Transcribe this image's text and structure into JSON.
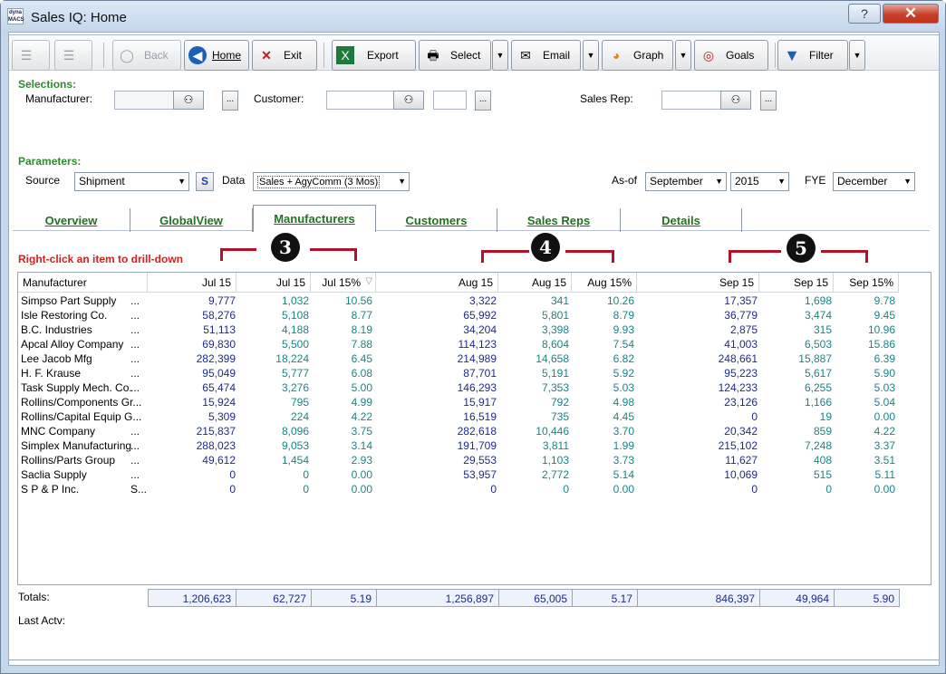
{
  "window": {
    "title": "Sales IQ: Home",
    "icon_text": "dyna MACS"
  },
  "toolbar": {
    "back": "Back",
    "home": "Home",
    "exit": "Exit",
    "export": "Export",
    "select": "Select",
    "email": "Email",
    "graph": "Graph",
    "goals": "Goals",
    "filter": "Filter"
  },
  "selections": {
    "heading": "Selections:",
    "manufacturer_label": "Manufacturer:",
    "customer_label": "Customer:",
    "sales_rep_label": "Sales Rep:",
    "ellipsis": "...",
    "binoculars": "⚇"
  },
  "parameters": {
    "heading": "Parameters:",
    "source_label": "Source",
    "source_value": "Shipment",
    "s_button": "S",
    "data_label": "Data",
    "data_value": "Sales + AgyComm (3 Mos)",
    "asof_label": "As-of",
    "asof_month": "September",
    "asof_year": "2015",
    "fye_label": "FYE",
    "fye_value": "December"
  },
  "tabs": [
    "Overview",
    "GlobalView",
    "Manufacturers",
    "Customers",
    "Sales Reps",
    "Details"
  ],
  "hint": "Right-click an item to drill-down",
  "badges": [
    "3",
    "4",
    "5"
  ],
  "grid": {
    "headers": [
      "Manufacturer",
      "Jul 15",
      "Jul 15",
      "Jul 15%",
      "Aug 15",
      "Aug 15",
      "Aug 15%",
      "Sep 15",
      "Sep 15",
      "Sep 15%"
    ],
    "rows": [
      {
        "name": "Simpso Part Supply",
        "more": "...",
        "v": [
          "9,777",
          "1,032",
          "10.56",
          "3,322",
          "341",
          "10.26",
          "17,357",
          "1,698",
          "9.78"
        ]
      },
      {
        "name": "Isle Restoring Co.",
        "more": "...",
        "v": [
          "58,276",
          "5,108",
          "8.77",
          "65,992",
          "5,801",
          "8.79",
          "36,779",
          "3,474",
          "9.45"
        ]
      },
      {
        "name": "B.C. Industries",
        "more": "...",
        "v": [
          "51,113",
          "4,188",
          "8.19",
          "34,204",
          "3,398",
          "9.93",
          "2,875",
          "315",
          "10.96"
        ]
      },
      {
        "name": "Apcal Alloy Company",
        "more": "...",
        "v": [
          "69,830",
          "5,500",
          "7.88",
          "114,123",
          "8,604",
          "7.54",
          "41,003",
          "6,503",
          "15.86"
        ]
      },
      {
        "name": "Lee Jacob Mfg",
        "more": "...",
        "v": [
          "282,399",
          "18,224",
          "6.45",
          "214,989",
          "14,658",
          "6.82",
          "248,661",
          "15,887",
          "6.39"
        ]
      },
      {
        "name": "H. F. Krause",
        "more": "...",
        "v": [
          "95,049",
          "5,777",
          "6.08",
          "87,701",
          "5,191",
          "5.92",
          "95,223",
          "5,617",
          "5.90"
        ]
      },
      {
        "name": "Task Supply Mech. Co.",
        "more": "...",
        "v": [
          "65,474",
          "3,276",
          "5.00",
          "146,293",
          "7,353",
          "5.03",
          "124,233",
          "6,255",
          "5.03"
        ]
      },
      {
        "name": "Rollins/Components Gr...",
        "more": "",
        "v": [
          "15,924",
          "795",
          "4.99",
          "15,917",
          "792",
          "4.98",
          "23,126",
          "1,166",
          "5.04"
        ]
      },
      {
        "name": "Rollins/Capital Equip G...",
        "more": "",
        "v": [
          "5,309",
          "224",
          "4.22",
          "16,519",
          "735",
          "4.45",
          "0",
          "19",
          "0.00"
        ]
      },
      {
        "name": "MNC Company",
        "more": "...",
        "v": [
          "215,837",
          "8,096",
          "3.75",
          "282,618",
          "10,446",
          "3.70",
          "20,342",
          "859",
          "4.22"
        ]
      },
      {
        "name": "Simplex Manufacturing",
        "more": "...",
        "v": [
          "288,023",
          "9,053",
          "3.14",
          "191,709",
          "3,811",
          "1.99",
          "215,102",
          "7,248",
          "3.37"
        ]
      },
      {
        "name": "Rollins/Parts Group",
        "more": "...",
        "v": [
          "49,612",
          "1,454",
          "2.93",
          "29,553",
          "1,103",
          "3.73",
          "11,627",
          "408",
          "3.51"
        ]
      },
      {
        "name": "Saclia Supply",
        "more": "...",
        "v": [
          "0",
          "0",
          "0.00",
          "53,957",
          "2,772",
          "5.14",
          "10,069",
          "515",
          "5.11"
        ]
      },
      {
        "name": "S P & P Inc.",
        "more": "S...",
        "v": [
          "0",
          "0",
          "0.00",
          "0",
          "0",
          "0.00",
          "0",
          "0",
          "0.00"
        ]
      }
    ]
  },
  "totals": {
    "label": "Totals:",
    "values": [
      "1,206,623",
      "62,727",
      "5.19",
      "1,256,897",
      "65,005",
      "5.17",
      "846,397",
      "49,964",
      "5.90"
    ]
  },
  "last_activity_label": "Last Actv:",
  "colors": {
    "accent_green": "#2e8b2e",
    "navy_value": "#1f2a8c",
    "teal_value": "#1c8486",
    "callout_red": "#b0122a"
  }
}
